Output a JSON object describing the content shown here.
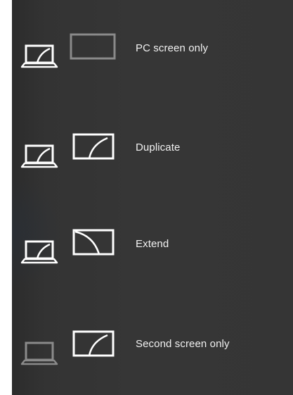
{
  "project_menu": {
    "options": [
      {
        "label": "PC screen only",
        "icon": "pc-screen-only-icon"
      },
      {
        "label": "Duplicate",
        "icon": "duplicate-icon"
      },
      {
        "label": "Extend",
        "icon": "extend-icon"
      },
      {
        "label": "Second screen only",
        "icon": "second-screen-only-icon"
      }
    ]
  },
  "colors": {
    "background": "#353535",
    "active_icon": "#ffffff",
    "dimmed_icon": "#8a8a8a",
    "text": "#f2f2f2"
  }
}
